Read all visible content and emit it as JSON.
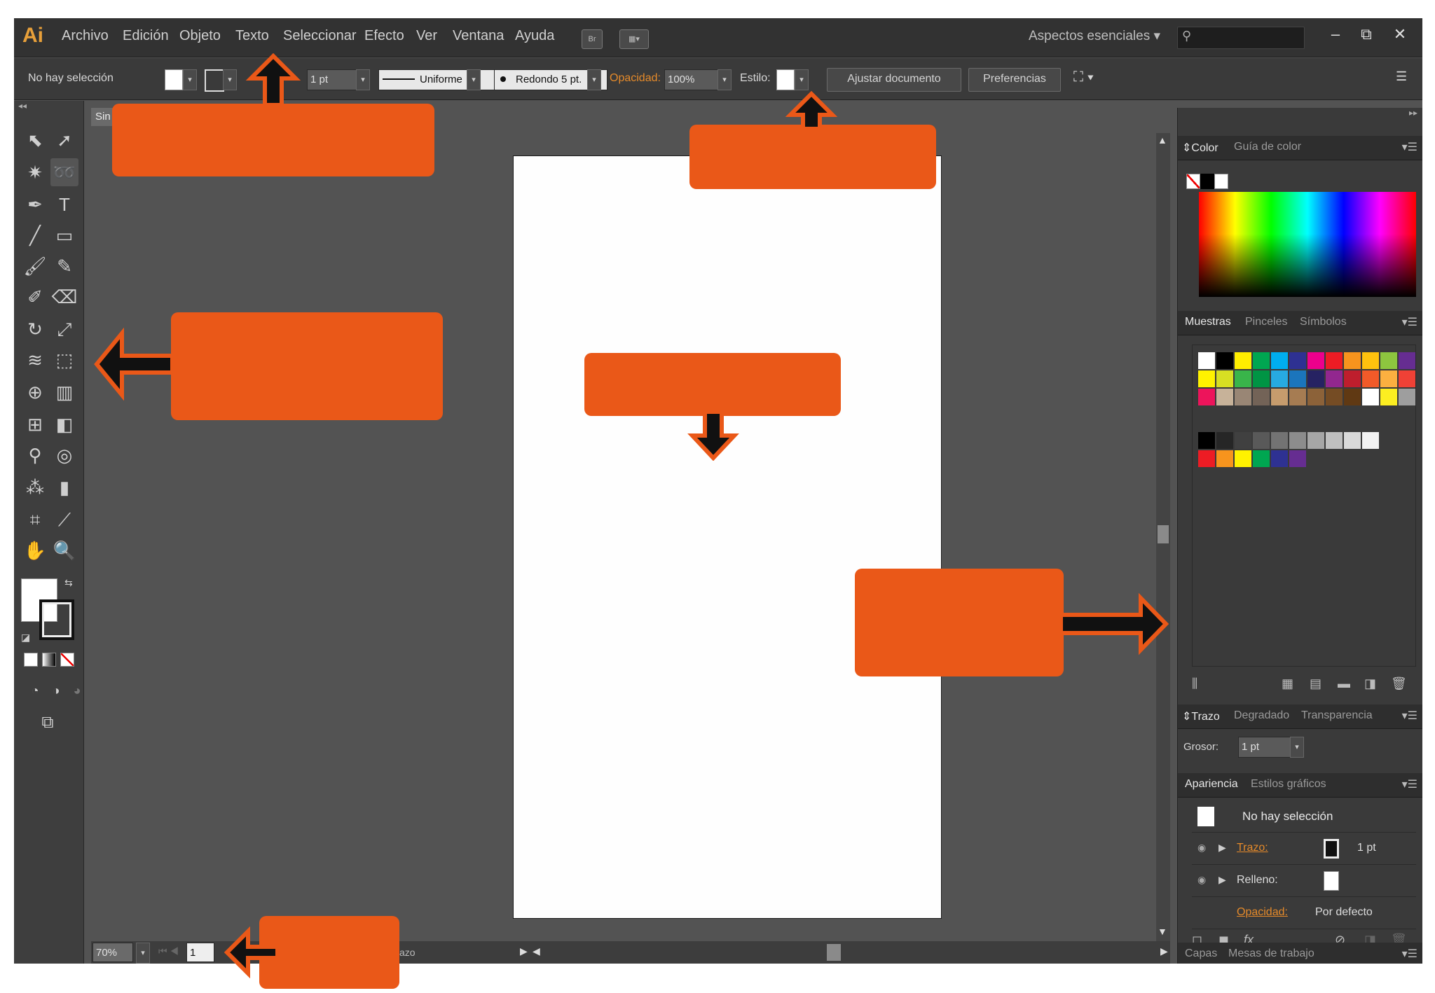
{
  "app": {
    "logo": "Ai",
    "menu": [
      "Archivo",
      "Edición",
      "Objeto",
      "Texto",
      "Seleccionar",
      "Efecto",
      "Ver",
      "Ventana",
      "Ayuda"
    ],
    "bridge_button": "Br",
    "workspace": "Aspectos esenciales",
    "window_buttons": [
      "‒",
      "⧉",
      "✕"
    ]
  },
  "control_bar": {
    "selection_status": "No hay selección",
    "stroke_weight": "1 pt",
    "profile": "Uniforme",
    "brush": "Redondo 5 pt.",
    "opacity_label": "Opacidad:",
    "opacity_value": "100%",
    "style_label": "Estilo:",
    "adjust_document": "Ajustar documento",
    "preferences": "Preferencias"
  },
  "document": {
    "tab_label": "Sin",
    "zoom": "70%",
    "page": "1",
    "status_fragment": "azo"
  },
  "panels": {
    "color": {
      "tabs": [
        "Color",
        "Guía de color"
      ]
    },
    "swatches": {
      "tabs": [
        "Muestras",
        "Pinceles",
        "Símbolos"
      ]
    },
    "stroke": {
      "tabs": [
        "Trazo",
        "Degradado",
        "Transparencia"
      ],
      "weight_label": "Grosor:",
      "weight_value": "1 pt"
    },
    "appearance": {
      "tabs": [
        "Apariencia",
        "Estilos gráficos"
      ],
      "title": "No hay selección",
      "stroke_label": "Trazo:",
      "stroke_value": "1 pt",
      "fill_label": "Relleno:",
      "opacity_label": "Opacidad:",
      "opacity_value": "Por defecto"
    },
    "layers": {
      "tabs": [
        "Capas",
        "Mesas de trabajo"
      ]
    }
  },
  "colors": {
    "callout": "#ea5818",
    "interface_dark": "#323232",
    "canvas": "#535353",
    "swatch_row1": [
      "#ffffff",
      "#000000",
      "#ffee00",
      "#00a651",
      "#00aeef",
      "#2e3192",
      "#ec008c",
      "#ed1c24",
      "#f7941d",
      "#ffc20e",
      "#8dc63f",
      "#662d91"
    ],
    "swatch_row2": [
      "#fff200",
      "#d7df23",
      "#39b54a",
      "#009444",
      "#27aae1",
      "#1b75bc",
      "#262262",
      "#92278f",
      "#be1e2d",
      "#f15a29",
      "#fbb040",
      "#ef4136"
    ],
    "swatch_row3": [
      "#ed145b",
      "#c7b299",
      "#998675",
      "#736357",
      "#c69c6d",
      "#a67c52",
      "#8c6239",
      "#754c24",
      "#603913",
      "#ffffff",
      "#fcee21",
      "#9e9e9e"
    ],
    "swatch_gray": [
      "#000000",
      "#262626",
      "#404040",
      "#595959",
      "#737373",
      "#8c8c8c",
      "#a6a6a6",
      "#bfbfbf",
      "#d9d9d9",
      "#f2f2f2"
    ],
    "swatch_bright": [
      "#ed1c24",
      "#f7941d",
      "#fff200",
      "#00a651",
      "#2e3192",
      "#662d91"
    ]
  }
}
